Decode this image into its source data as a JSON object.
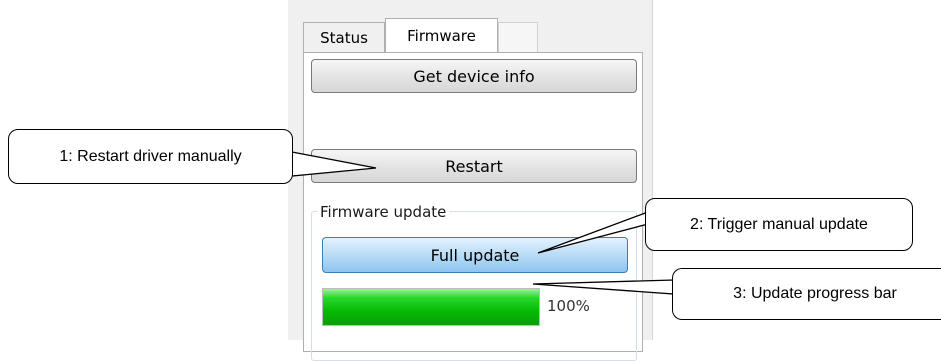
{
  "tabs": [
    {
      "label": "Status",
      "active": false
    },
    {
      "label": "Firmware",
      "active": true
    }
  ],
  "buttons": {
    "get_device_info": "Get device info",
    "restart": "Restart",
    "full_update": "Full update"
  },
  "firmware_update": {
    "group_label": "Firmware update",
    "progress_percent": 100,
    "progress_text": "100%"
  },
  "callouts": {
    "c1": "1: Restart driver manually",
    "c2": "2: Trigger manual update",
    "c3": "3: Update progress bar"
  },
  "colors": {
    "progress_green": "#06bb06",
    "primary_button_blue": "#8dc5ef"
  }
}
